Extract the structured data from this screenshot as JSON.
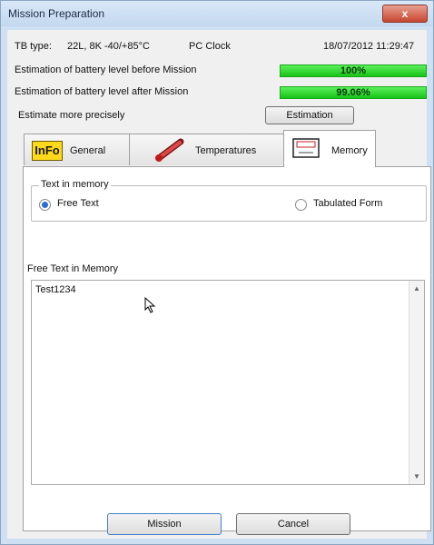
{
  "window": {
    "title": "Mission Preparation",
    "close_glyph": "x"
  },
  "info": {
    "tb_type_label": "TB type:",
    "tb_type_value": "22L, 8K -40/+85°C",
    "pc_clock_label": "PC Clock",
    "pc_clock_value": "18/07/2012 11:29:47",
    "battery_before_label": "Estimation of battery level before Mission",
    "battery_before_value": "100%",
    "battery_after_label": "Estimation of battery level after Mission",
    "battery_after_value": "99.06%",
    "estimate_label": "Estimate more precisely",
    "estimation_button": "Estimation"
  },
  "tabs": [
    {
      "label": "General",
      "icon": "info-icon",
      "icon_text": "InFo"
    },
    {
      "label": "Temperatures",
      "icon": "thermometer-icon"
    },
    {
      "label": "Memory",
      "icon": "memory-card-icon",
      "active": true
    }
  ],
  "memory": {
    "group_label": "Text in memory",
    "free_text_option": "Free Text",
    "tabulated_option": "Tabulated Form",
    "selected": "Free Text",
    "textarea_label": "Free Text in Memory",
    "textarea_value": "Test1234"
  },
  "buttons": {
    "mission": "Mission",
    "cancel": "Cancel"
  },
  "colors": {
    "title_bar": "#c3d8ef",
    "progress": "#18c318",
    "close": "#c8452f"
  }
}
